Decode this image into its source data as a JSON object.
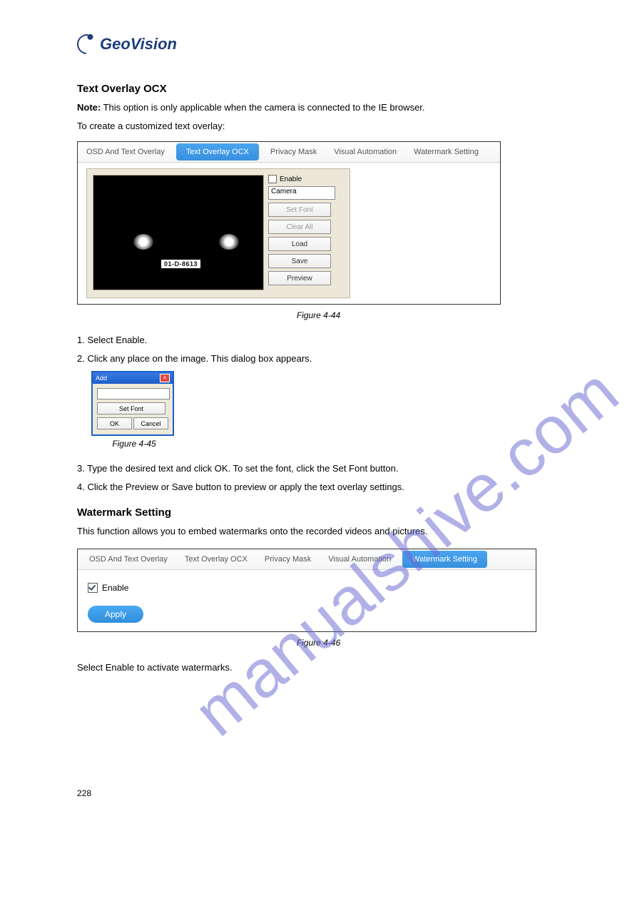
{
  "logo_text": "GeoVision",
  "watermark": "manualshive.com",
  "section1": {
    "title": "Text Overlay OCX",
    "note_label": "Note:",
    "note_text": "This option is only applicable when the camera is connected to the IE browser.",
    "para_intro": "To create a customized text overlay:"
  },
  "fig1": {
    "tabs": {
      "osd": "OSD And Text Overlay",
      "ocx": "Text Overlay OCX",
      "privacy": "Privacy Mask",
      "visual": "Visual Automation",
      "watermark": "Watermark Setting"
    },
    "enable": "Enable",
    "camera_value": "Camera",
    "plate": "01-D-8613",
    "buttons": {
      "setfont": "Set Font",
      "clearall": "Clear All",
      "load": "Load",
      "save": "Save",
      "preview": "Preview"
    },
    "caption": "Figure 4-44"
  },
  "steps": {
    "s1": "1. Select Enable.",
    "s2": "2. Click any place on the image. This dialog box appears.",
    "add_dlg": {
      "title": "Add",
      "setfont": "Set Font",
      "ok": "OK",
      "cancel": "Cancel"
    },
    "fig45": "Figure 4-45",
    "s3": "3. Type the desired text and click OK. To set the font, click the Set Font button.",
    "s4": "4. Click the Preview or Save button to preview or apply the text overlay settings."
  },
  "section2": {
    "title": "Watermark Setting",
    "para": "This function allows you to embed watermarks onto the recorded videos and pictures."
  },
  "fig2": {
    "tabs": {
      "osd": "OSD And Text Overlay",
      "ocx": "Text Overlay OCX",
      "privacy": "Privacy Mask",
      "visual": "Visual Automation",
      "watermark": "Watermark Setting"
    },
    "enable": "Enable",
    "apply": "Apply",
    "caption": "Figure 4-46"
  },
  "closing": "Select Enable to activate watermarks.",
  "page_number": "228"
}
